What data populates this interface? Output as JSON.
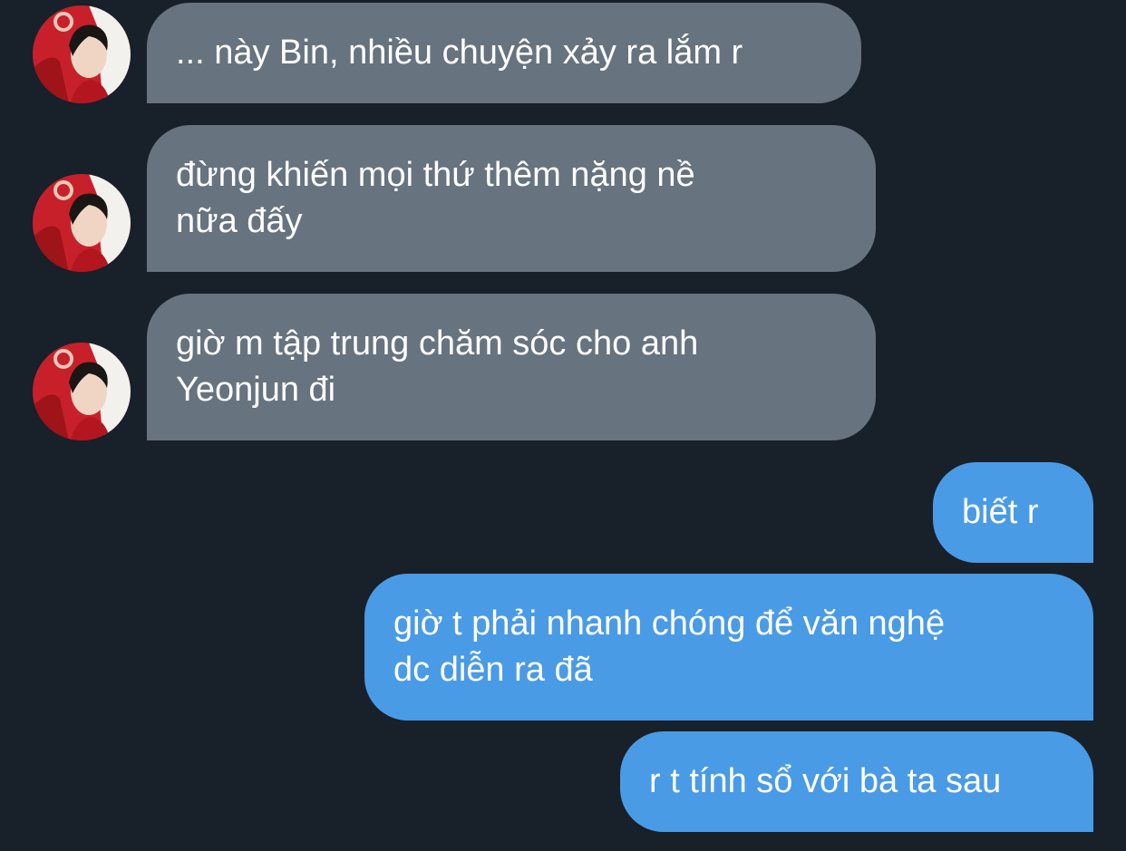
{
  "conversation": {
    "messages": [
      {
        "direction": "incoming",
        "text": "... này Bin, nhiều chuyện xảy ra lắm r"
      },
      {
        "direction": "incoming",
        "text": "đừng khiến mọi thứ thêm nặng nề\nnữa đấy"
      },
      {
        "direction": "incoming",
        "text": "giờ m tập trung chăm sóc cho anh\nYeonjun đi"
      },
      {
        "direction": "outgoing",
        "text": "biết r"
      },
      {
        "direction": "outgoing",
        "text": "giờ t phải nhanh chóng để văn nghệ\ndc diễn ra đã"
      },
      {
        "direction": "outgoing",
        "text": "r t tính sổ với bà ta sau"
      }
    ]
  },
  "colors": {
    "background": "#18202a",
    "incoming_bubble": "#67737f",
    "outgoing_bubble": "#4a9be6",
    "text": "#ffffff",
    "avatar_accent": "#c8202a"
  },
  "icons": {
    "avatar": "contact-avatar-photo"
  }
}
